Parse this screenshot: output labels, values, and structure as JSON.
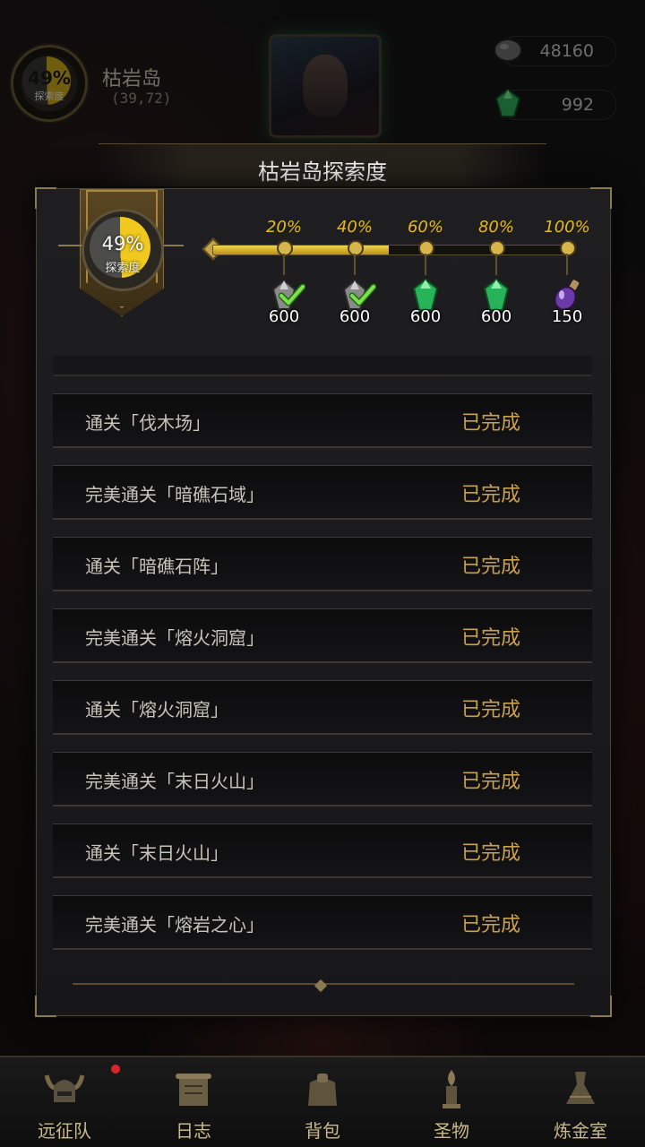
{
  "hud": {
    "progress_pct": "49%",
    "progress_label": "探索度",
    "island_name": "枯岩岛",
    "island_coord": "(39,72)",
    "stone_amount": "48160",
    "gem_amount": "992"
  },
  "modal": {
    "title": "枯岩岛探索度",
    "progress_pct": "49%",
    "progress_label": "探索度",
    "progress_value": 0.49,
    "milestones": [
      {
        "pct": "20%",
        "reward": "600",
        "icon": "grey-crystal-icon",
        "claimed": true
      },
      {
        "pct": "40%",
        "reward": "600",
        "icon": "grey-crystal-icon",
        "claimed": true
      },
      {
        "pct": "60%",
        "reward": "600",
        "icon": "green-crystal-icon",
        "claimed": false
      },
      {
        "pct": "80%",
        "reward": "600",
        "icon": "green-crystal-icon",
        "claimed": false
      },
      {
        "pct": "100%",
        "reward": "150",
        "icon": "purple-potion-icon",
        "claimed": false
      }
    ],
    "tasks": [
      {
        "name": "通关「伐木场」",
        "status": "已完成"
      },
      {
        "name": "完美通关「暗礁石域」",
        "status": "已完成"
      },
      {
        "name": "通关「暗礁石阵」",
        "status": "已完成"
      },
      {
        "name": "完美通关「熔火洞窟」",
        "status": "已完成"
      },
      {
        "name": "通关「熔火洞窟」",
        "status": "已完成"
      },
      {
        "name": "完美通关「末日火山」",
        "status": "已完成"
      },
      {
        "name": "通关「末日火山」",
        "status": "已完成"
      },
      {
        "name": "完美通关「熔岩之心」",
        "status": "已完成"
      }
    ]
  },
  "nav": {
    "items": [
      {
        "label": "远征队",
        "icon": "horned-helmet-icon"
      },
      {
        "label": "日志",
        "icon": "scroll-icon"
      },
      {
        "label": "背包",
        "icon": "bag-icon"
      },
      {
        "label": "圣物",
        "icon": "relic-torch-icon"
      },
      {
        "label": "炼金室",
        "icon": "alchemy-icon"
      }
    ]
  },
  "colors": {
    "accent_gold": "#e8b81c",
    "status_gold": "#c9a24e",
    "notification_red": "#d6262a"
  }
}
